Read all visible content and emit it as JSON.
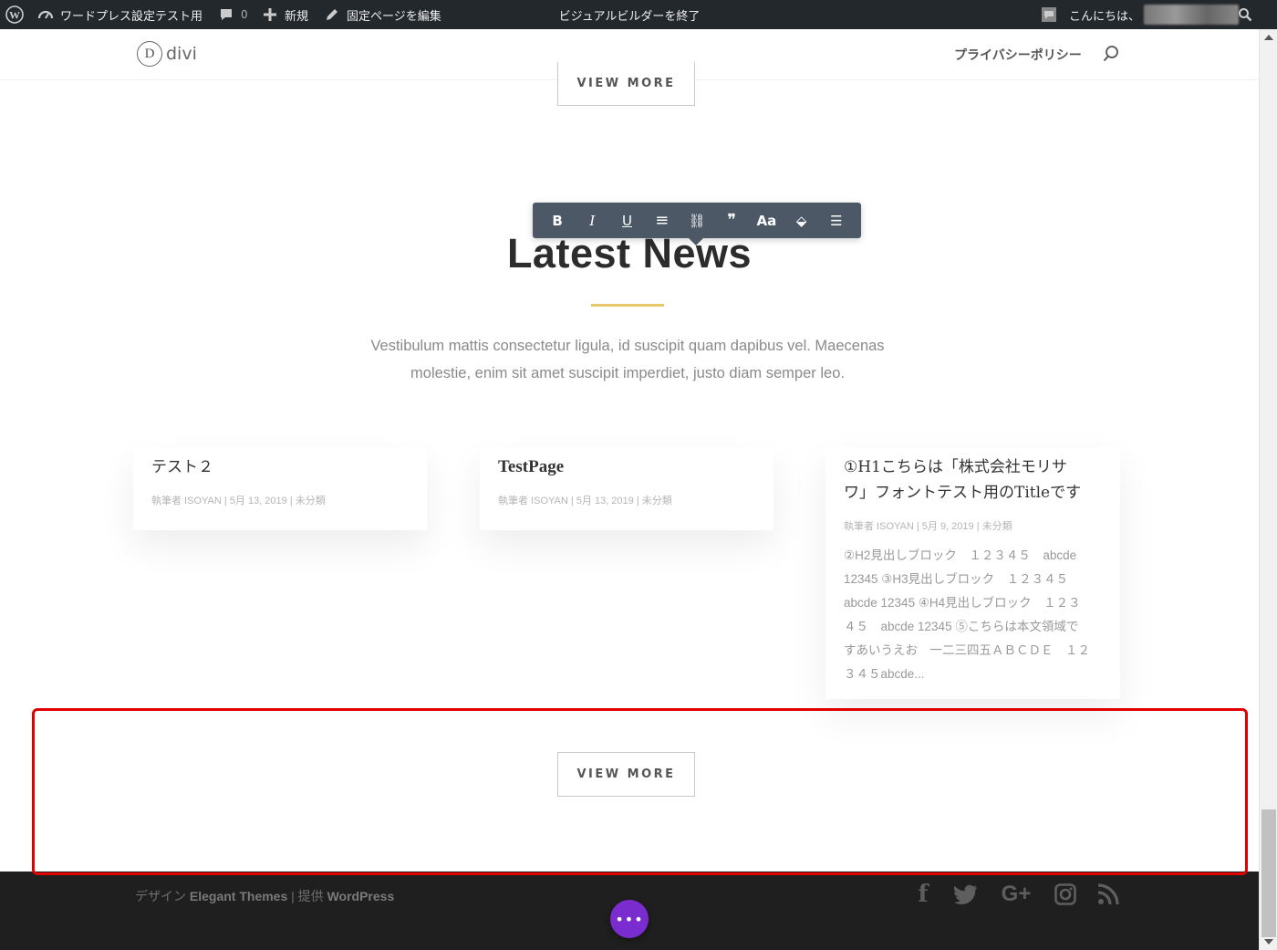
{
  "adminbar": {
    "site_name": "ワードプレス設定テスト用",
    "comments_count": "0",
    "new_label": "新規",
    "edit_label": "固定ページを編集",
    "exit_builder_label": "ビジュアルビルダーを終了",
    "greeting": "こんにちは、"
  },
  "header": {
    "logo_letter": "D",
    "logo_text": "divi",
    "nav_privacy": "プライバシーポリシー"
  },
  "toolbar": {
    "bold": "B",
    "italic": "I",
    "underline": "U",
    "align": "≡",
    "link": "⛓",
    "quote": "❞",
    "font_size": "Aa",
    "color": "⬙",
    "list": "☰"
  },
  "section": {
    "view_more_top": "VIEW MORE",
    "heading": "Latest News",
    "intro_line1": "Vestibulum mattis consectetur ligula, id suscipit quam dapibus vel. Maecenas",
    "intro_line2": "molestie, enim sit amet suscipit imperdiet, justo diam semper leo.",
    "view_more_bottom": "VIEW MORE"
  },
  "posts": [
    {
      "title": "テスト２",
      "meta": "執筆者 ISOYAN | 5月 13, 2019 | 未分類"
    },
    {
      "title": "TestPage",
      "meta": "執筆者 ISOYAN | 5月 13, 2019 | 未分類"
    },
    {
      "title_line1": "①H1こちらは「株式会社モリサ",
      "title_line2": "ワ」フォントテスト用のTitleです",
      "meta": "執筆者 ISOYAN | 5月 9, 2019 | 未分類",
      "excerpt_lines": [
        "②H2見出しブロック　１２３４５　abcde",
        "12345 ③H3見出しブロック　１２３４５",
        "abcde 12345 ④H4見出しブロック　１２３",
        "４５　abcde 12345 ⑤こちらは本文領域で",
        "すあいうえお　一二三四五ＡＢＣＤＥ　１２",
        "３４５abcde..."
      ]
    }
  ],
  "footer": {
    "credits_prefix": "デザイン",
    "credits_theme": "Elegant Themes",
    "credits_mid": "| 提供",
    "credits_wp": "WordPress",
    "social": {
      "facebook": "f",
      "googleplus": "G+"
    },
    "fab_label": "•••"
  },
  "colors": {
    "adminbar_bg": "#23282d",
    "accent_divider": "#e8c76a",
    "highlight_border": "#e00000",
    "footer_bg": "#1f1f1f",
    "fab_bg": "#7b2ccf",
    "toolbar_bg": "#4c5866"
  }
}
